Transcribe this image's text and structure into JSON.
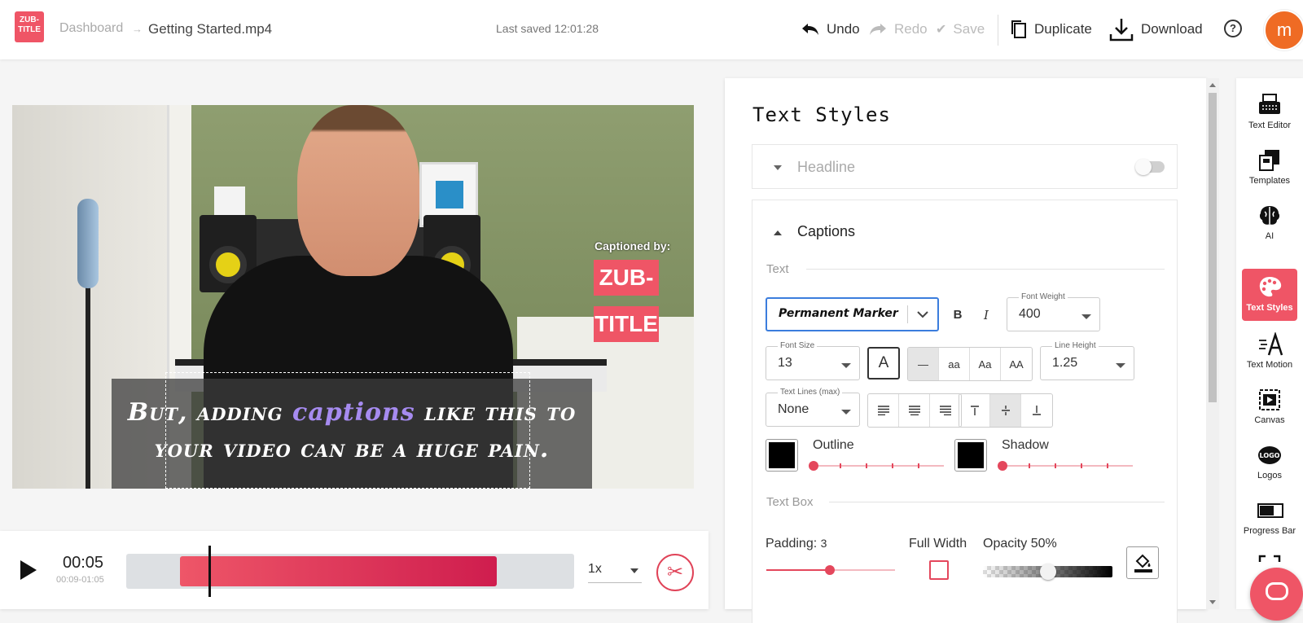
{
  "header": {
    "logo_text": "ZUB-TITLE",
    "breadcrumb_root": "Dashboard",
    "breadcrumb_sep": "→",
    "file_name": "Getting Started.mp4",
    "last_saved": "Last saved 12:01:28",
    "undo": "Undo",
    "redo": "Redo",
    "save": "Save",
    "duplicate": "Duplicate",
    "download": "Download",
    "help": "?",
    "avatar": "m"
  },
  "video": {
    "captioned_by": "Captioned by:",
    "badge_line1": "ZUB-",
    "badge_line2": "TITLE",
    "caption_pre": "But, adding ",
    "caption_highlight": "captions",
    "caption_post": " like this to",
    "caption_line2": "your video can be a huge pain."
  },
  "player": {
    "time": "00:05",
    "range": "00:09-01:05",
    "speed": "1x",
    "progress_fraction": 0.09
  },
  "panel": {
    "title": "Text Styles",
    "headline_label": "Headline",
    "captions_label": "Captions",
    "text_section": "Text",
    "font_name": "Permanent Marker",
    "bold": "B",
    "italic": "I",
    "font_weight_label": "Font Weight",
    "font_weight": "400",
    "font_size_label": "Font Size",
    "font_size": "13",
    "color_button": "A",
    "case_options": [
      "—",
      "aa",
      "Aa",
      "AA"
    ],
    "line_height_label": "Line Height",
    "line_height": "1.25",
    "text_lines_label": "Text Lines (max)",
    "text_lines": "None",
    "outline_label": "Outline",
    "shadow_label": "Shadow",
    "outline_color": "#000000",
    "shadow_color": "#000000",
    "text_box_section": "Text Box",
    "padding_label": "Padding:",
    "padding_value": "3",
    "full_width_label": "Full Width",
    "opacity_label": "Opacity 50%",
    "opacity_value": 0.5
  },
  "sidebar": {
    "items": [
      {
        "label": "Text Editor",
        "icon": "typewriter-icon"
      },
      {
        "label": "Templates",
        "icon": "templates-icon"
      },
      {
        "label": "AI",
        "icon": "brain-icon"
      },
      {
        "label": "Text Styles",
        "icon": "palette-icon"
      },
      {
        "label": "Text Motion",
        "icon": "text-motion-icon"
      },
      {
        "label": "Canvas",
        "icon": "canvas-icon"
      },
      {
        "label": "Logos",
        "icon": "logo-icon"
      },
      {
        "label": "Progress Bar",
        "icon": "progress-bar-icon"
      }
    ]
  },
  "colors": {
    "accent": "#ef5566",
    "caption_highlight": "#a68bf0",
    "avatar": "#ef6b24"
  }
}
